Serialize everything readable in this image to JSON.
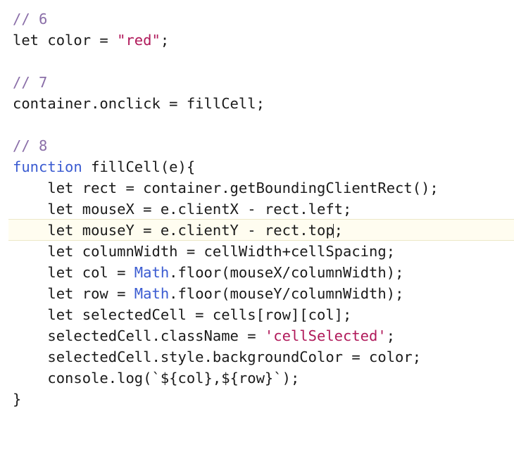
{
  "code": {
    "l1": "// 6",
    "l2_a": "let color = ",
    "l2_str": "\"red\"",
    "l2_b": ";",
    "l4": "// 7",
    "l5": "container.onclick = fillCell;",
    "l7": "// 8",
    "l8_kw": "function",
    "l8_rest": " fillCell(e){",
    "l9": "    let rect = container.getBoundingClientRect();",
    "l10": "    let mouseX = e.clientX - rect.left;",
    "l11_a": "    let mouseY = e.clientY - rect.top",
    "l11_b": ";",
    "l12": "    let columnWidth = cellWidth+cellSpacing;",
    "l13_a": "    let col = ",
    "l13_math": "Math",
    "l13_b": ".floor(mouseX/columnWidth);",
    "l14_a": "    let row = ",
    "l14_math": "Math",
    "l14_b": ".floor(mouseY/columnWidth);",
    "l15": "    let selectedCell = cells[row][col];",
    "l16_a": "    selectedCell.className = ",
    "l16_str": "'cellSelected'",
    "l16_b": ";",
    "l17": "    selectedCell.style.backgroundColor = color;",
    "l18": "    console.log(`${col},${row}`);",
    "l19": "}"
  },
  "colors": {
    "comment": "#8a6ea8",
    "string": "#b0195a",
    "keyword": "#3a5bd1",
    "text": "#1a1a1a",
    "active_line_bg": "#fffdf0"
  }
}
